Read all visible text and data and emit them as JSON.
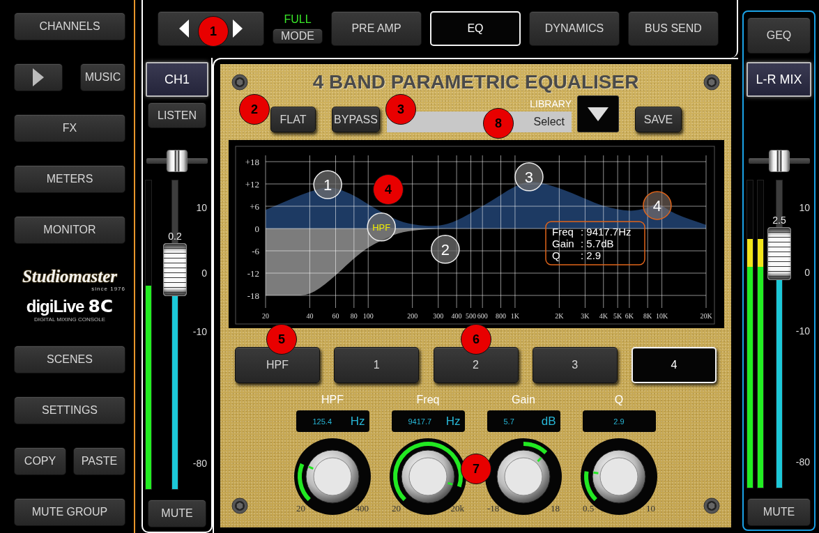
{
  "sidebar": {
    "channels": "CHANNELS",
    "music": "MUSIC",
    "buttons_upper": [
      "FX",
      "METERS",
      "MONITOR"
    ],
    "logo": {
      "brand": "Studiomaster",
      "since": "since 1976",
      "product": "digiLive",
      "model": "8C",
      "tagline": "DIGITAL MIXING CONSOLE"
    },
    "buttons_lower": [
      "SCENES",
      "SETTINGS"
    ],
    "copy": "COPY",
    "paste": "PASTE",
    "mute_group": "MUTE GROUP"
  },
  "top_bar": {
    "mode_status": "FULL",
    "mode_button": "MODE",
    "tabs": [
      {
        "label": "PRE AMP",
        "selected": false
      },
      {
        "label": "EQ",
        "selected": true
      },
      {
        "label": "DYNAMICS",
        "selected": false
      },
      {
        "label": "BUS SEND",
        "selected": false
      }
    ]
  },
  "channel_strip": {
    "name": "CH1",
    "listen": "LISTEN",
    "pan": {
      "level": 0.5
    },
    "meters": [
      {
        "level": 0.66
      }
    ],
    "fader": {
      "level": 0.71,
      "value": "0.2"
    },
    "scale": [
      "10",
      "0",
      "-10",
      "-80"
    ],
    "mute": "MUTE"
  },
  "master_strip": {
    "geq": "GEQ",
    "name": "L-R MIX",
    "pan": {
      "level": 0.5
    },
    "meters": [
      {
        "level": 0.81
      },
      {
        "level": 0.81
      }
    ],
    "fader": {
      "level": 0.76,
      "value": "2.5"
    },
    "scale": [
      "10",
      "0",
      "-10",
      "-80"
    ],
    "mute": "MUTE"
  },
  "eq": {
    "title": "4 BAND PARAMETRIC EQUALISER",
    "flat": "FLAT",
    "bypass": "BYPASS",
    "library": {
      "label": "LIBRARY",
      "value": "Select"
    },
    "save": "SAVE",
    "graph": {
      "y_labels": [
        "+18",
        "+12",
        "+6",
        "0",
        "-6",
        "-12",
        "-18"
      ],
      "x_labels": [
        "20",
        "40",
        "60",
        "80",
        "100",
        "200",
        "300",
        "400",
        "500",
        "600",
        "800",
        "1K",
        "2K",
        "3K",
        "4K",
        "5K",
        "6K",
        "8K",
        "10K",
        "20K"
      ],
      "nodes": [
        {
          "label": "1",
          "selected": false
        },
        {
          "label": "HPF",
          "selected": false
        },
        {
          "label": "2",
          "selected": false
        },
        {
          "label": "3",
          "selected": false
        },
        {
          "label": "4",
          "selected": true
        }
      ],
      "readout": [
        {
          "label": "Freq",
          "value": ": 9417.7Hz"
        },
        {
          "label": "Gain",
          "value": ": 5.7dB"
        },
        {
          "label": "Q",
          "value": ": 2.9"
        }
      ]
    },
    "bands": [
      {
        "label": "HPF",
        "selected": false
      },
      {
        "label": "1",
        "selected": false
      },
      {
        "label": "2",
        "selected": false
      },
      {
        "label": "3",
        "selected": false
      },
      {
        "label": "4",
        "selected": true
      }
    ],
    "controls": [
      {
        "label": "HPF",
        "value": "125.4",
        "unit": "Hz",
        "min": "20",
        "max": "400",
        "kind": "unipolar",
        "level": 0.25
      },
      {
        "label": "Freq",
        "value": "9417.7",
        "unit": "Hz",
        "min": "20",
        "max": "20k",
        "kind": "unipolar",
        "level": 0.9
      },
      {
        "label": "Gain",
        "value": "5.7",
        "unit": "dB",
        "min": "-18",
        "max": "18",
        "kind": "bipolar",
        "level": 0.66
      },
      {
        "label": "Q",
        "value": "2.9",
        "min": "0.5",
        "max": "10",
        "kind": "unipolar",
        "level": 0.2
      }
    ]
  },
  "callouts": [
    "1",
    "2",
    "3",
    "4",
    "5",
    "6",
    "7",
    "8"
  ]
}
